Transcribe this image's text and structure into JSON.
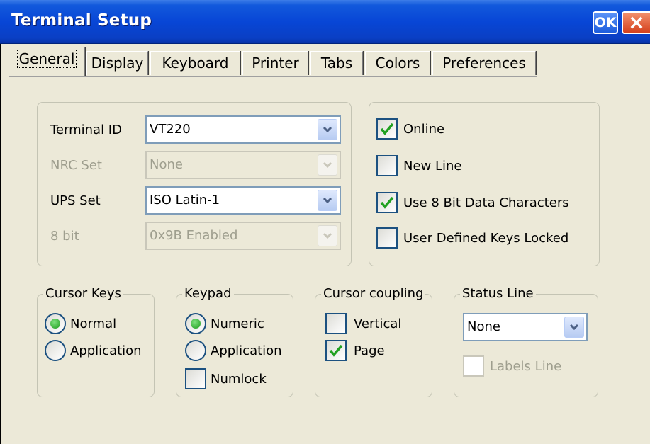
{
  "window": {
    "title": "Terminal Setup",
    "ok_label": "OK",
    "close_icon": "close-icon"
  },
  "tabs": [
    {
      "label": "General",
      "active": true
    },
    {
      "label": "Display"
    },
    {
      "label": "Keyboard"
    },
    {
      "label": "Printer"
    },
    {
      "label": "Tabs"
    },
    {
      "label": "Colors"
    },
    {
      "label": "Preferences"
    }
  ],
  "terminal": {
    "terminal_id": {
      "label": "Terminal ID",
      "value": "VT220"
    },
    "nrc_set": {
      "label": "NRC Set",
      "value": "None",
      "disabled": true
    },
    "ups_set": {
      "label": "UPS Set",
      "value": "ISO Latin-1"
    },
    "eight_bit": {
      "label": "8 bit",
      "value": "0x9B Enabled",
      "disabled": true
    }
  },
  "options": [
    {
      "label": "Online",
      "checked": true
    },
    {
      "label": "New Line",
      "checked": false
    },
    {
      "label": "Use 8 Bit Data Characters",
      "checked": true
    },
    {
      "label": "User Defined Keys Locked",
      "checked": false
    }
  ],
  "cursor_keys": {
    "legend": "Cursor Keys",
    "options": [
      {
        "label": "Normal",
        "selected": true
      },
      {
        "label": "Application",
        "selected": false
      }
    ]
  },
  "keypad": {
    "legend": "Keypad",
    "options": [
      {
        "label": "Numeric",
        "selected": true
      },
      {
        "label": "Application",
        "selected": false
      }
    ],
    "numlock": {
      "label": "Numlock",
      "checked": false
    }
  },
  "cursor_coupling": {
    "legend": "Cursor coupling",
    "vertical": {
      "label": "Vertical",
      "checked": false
    },
    "page": {
      "label": "Page",
      "checked": true
    }
  },
  "status_line": {
    "legend": "Status Line",
    "value": "None",
    "labels_line": {
      "label": "Labels Line",
      "checked": false,
      "disabled": true
    }
  },
  "colors": {
    "title_bar": "#0846d6",
    "face": "#ece9d8",
    "check_green": "#21a121"
  }
}
